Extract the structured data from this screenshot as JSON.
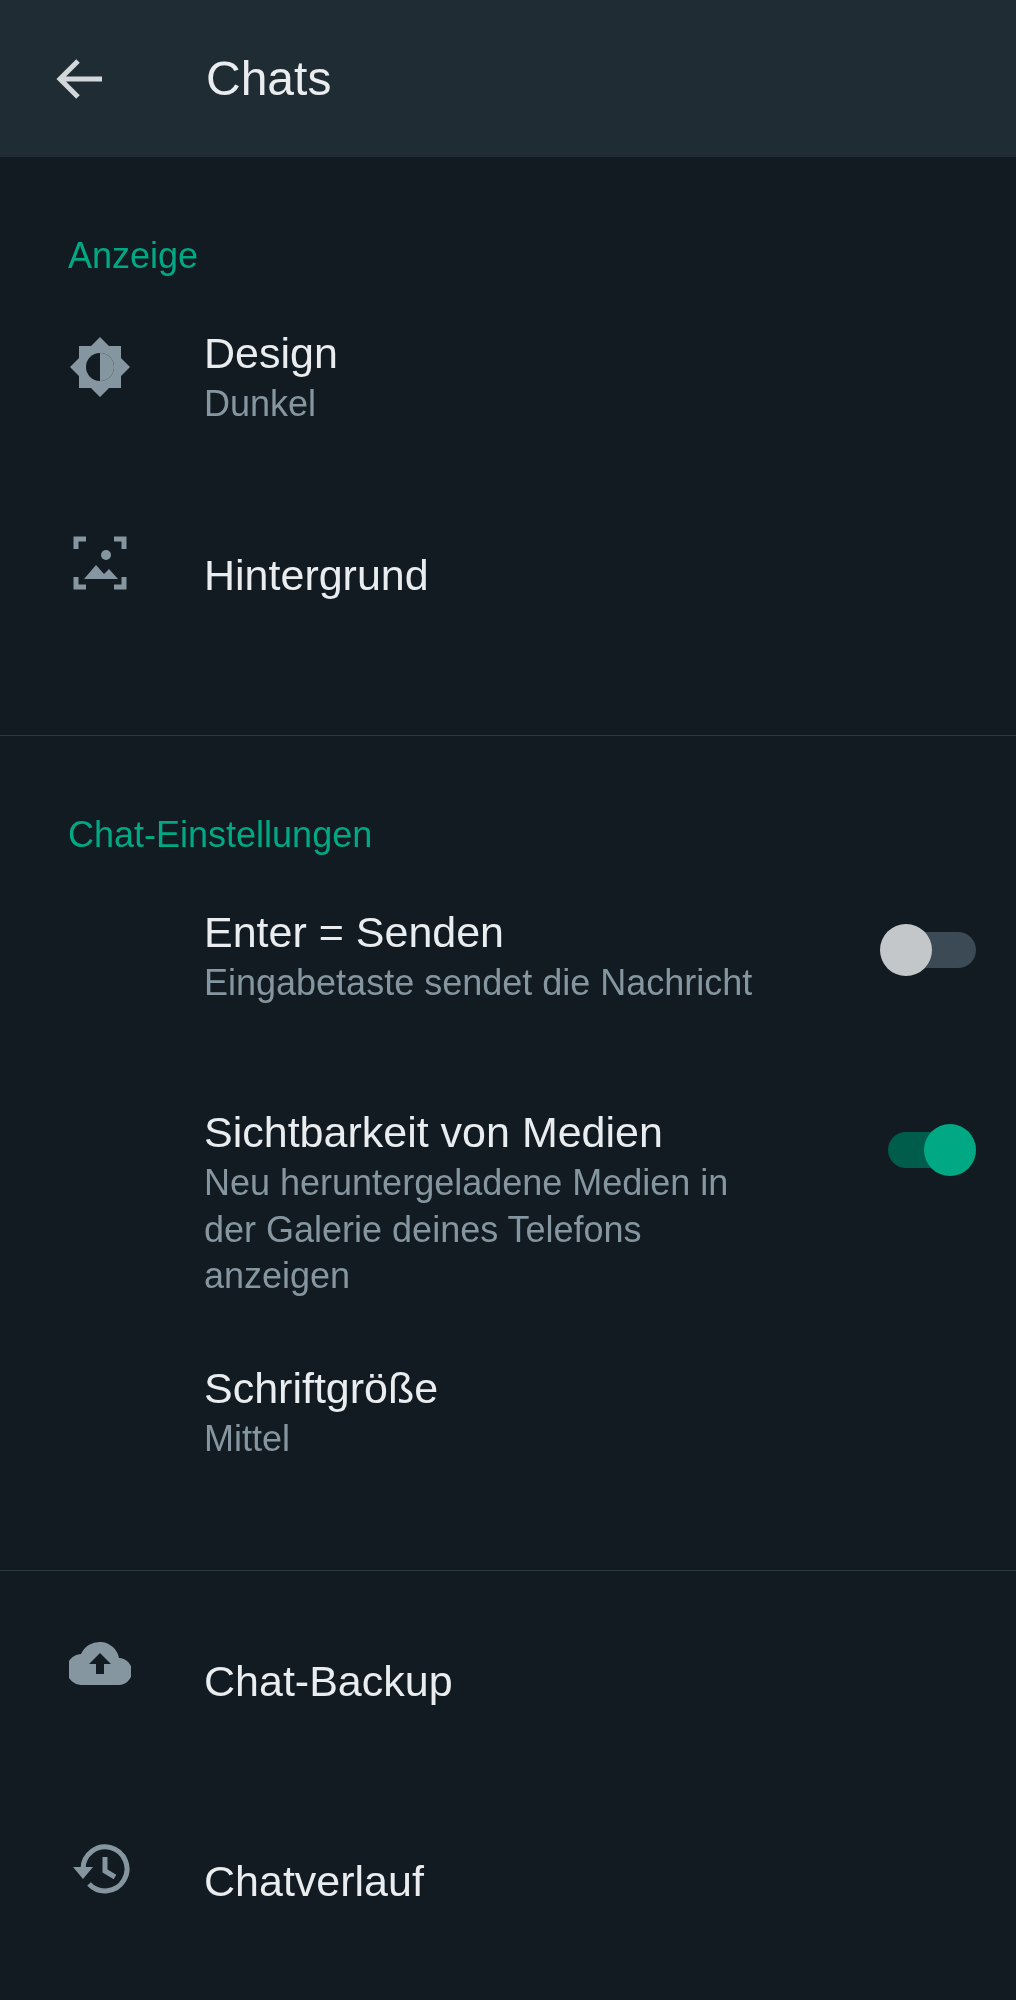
{
  "header": {
    "title": "Chats"
  },
  "sections": [
    {
      "title": "Anzeige",
      "items": [
        {
          "kind": "plain",
          "title": "Design",
          "subtitle": "Dunkel"
        },
        {
          "kind": "plain",
          "title": "Hintergrund"
        }
      ]
    },
    {
      "title": "Chat-Einstellungen",
      "items": [
        {
          "kind": "toggle",
          "title": "Enter = Senden",
          "subtitle": "Eingabetaste sendet die Nachricht",
          "on": false
        },
        {
          "kind": "toggle",
          "title": "Sichtbarkeit von Medien",
          "subtitle": "Neu heruntergeladene Medien in der Galerie deines Telefons anzeigen",
          "on": true
        },
        {
          "kind": "plain",
          "title": "Schriftgröße",
          "subtitle": "Mittel"
        }
      ]
    },
    {
      "items": [
        {
          "kind": "plain",
          "title": "Chat-Backup"
        },
        {
          "kind": "plain",
          "title": "Chatverlauf"
        }
      ]
    }
  ]
}
